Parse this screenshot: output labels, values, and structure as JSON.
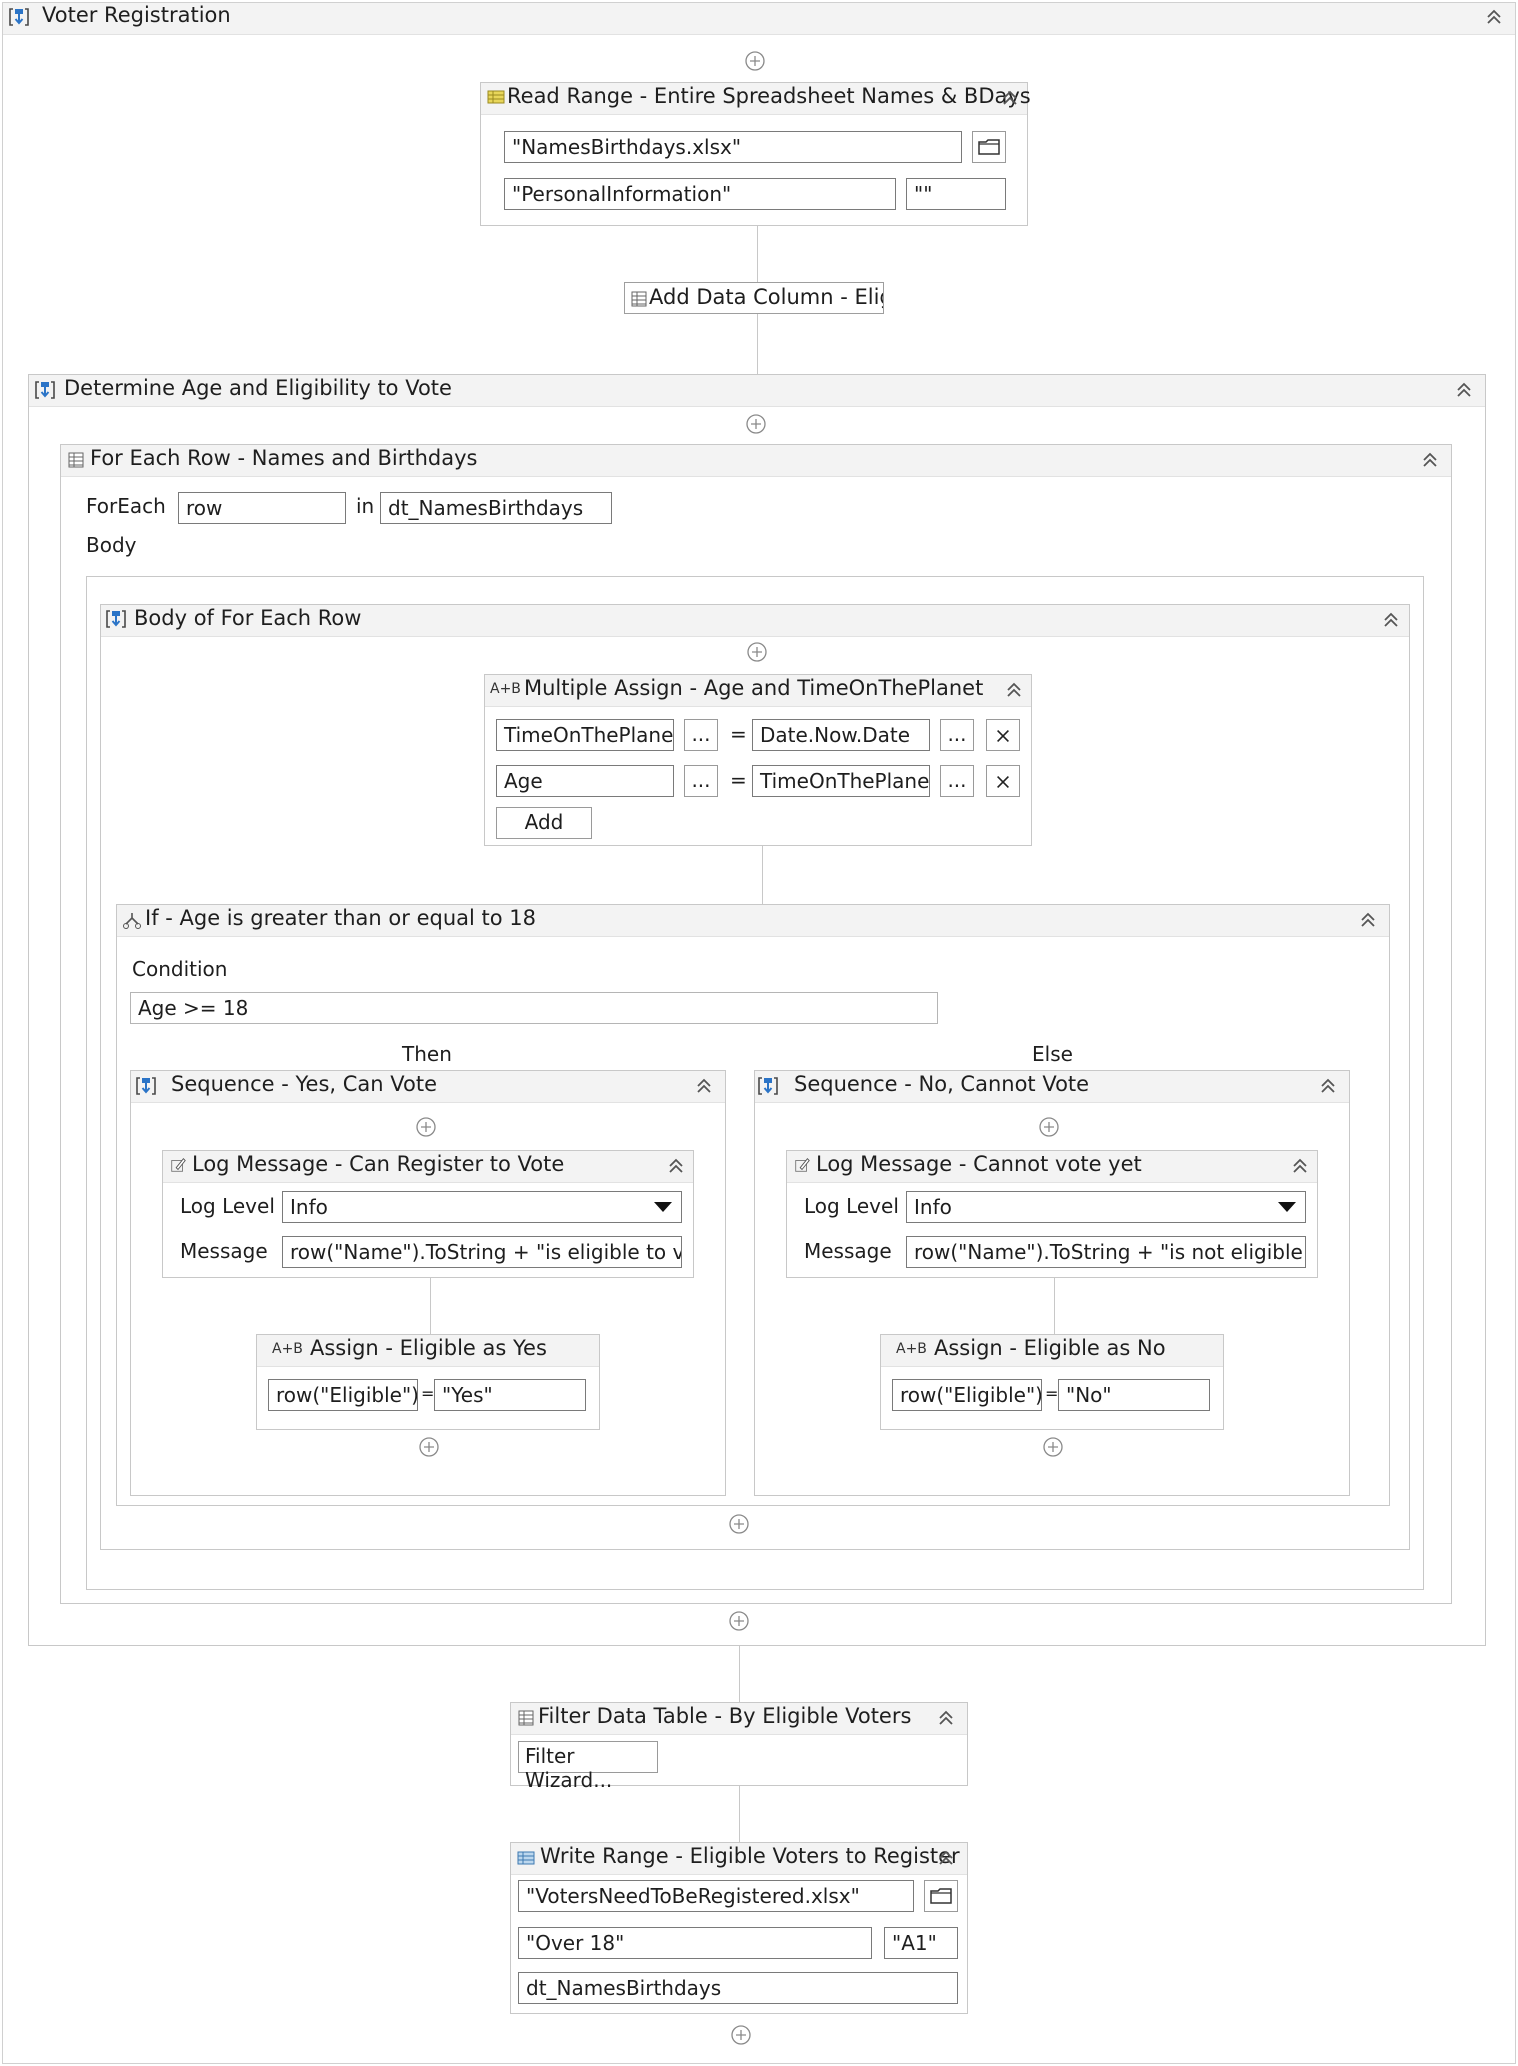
{
  "root": {
    "title": "Voter Registration"
  },
  "read_range": {
    "title": "Read Range - Entire Spreadsheet Names & BDays",
    "file": "\"NamesBirthdays.xlsx\"",
    "sheet": "\"PersonalInformation\"",
    "range": "\"\""
  },
  "add_column": {
    "title": "Add Data Column - Eligib"
  },
  "determine": {
    "title": "Determine Age and Eligibility to Vote"
  },
  "foreach": {
    "title": "For Each Row - Names and Birthdays",
    "foreach_label": "ForEach",
    "item": "row",
    "in_label": "in",
    "collection": "dt_NamesBirthdays",
    "body_label": "Body"
  },
  "body_seq": {
    "title": "Body of For Each Row"
  },
  "multi_assign": {
    "title": "Multiple Assign - Age and TimeOnThePlanet",
    "rows": [
      {
        "to": "TimeOnThePlanet",
        "value": "Date.Now.Date"
      },
      {
        "to": "Age",
        "value": "TimeOnThePlanet"
      }
    ],
    "ellipsis": "...",
    "equals": "=",
    "add_label": "Add"
  },
  "if_block": {
    "title": "If - Age is greater than or equal to 18",
    "condition_label": "Condition",
    "condition": "Age >= 18",
    "then_label": "Then",
    "else_label": "Else"
  },
  "then_seq": {
    "title": "Sequence - Yes, Can Vote",
    "log": {
      "title": "Log Message - Can Register to Vote",
      "level_label": "Log Level",
      "level": "Info",
      "message_label": "Message",
      "message": "row(\"Name\").ToString + \"is eligible to vote"
    },
    "assign": {
      "title": "Assign - Eligible as Yes",
      "to": "row(\"Eligible\")",
      "eq": "=",
      "value": "\"Yes\""
    }
  },
  "else_seq": {
    "title": "Sequence - No, Cannot Vote",
    "log": {
      "title": "Log Message - Cannot vote yet",
      "level_label": "Log Level",
      "level": "Info",
      "message_label": "Message",
      "message": "row(\"Name\").ToString + \"is not eligible to"
    },
    "assign": {
      "title": "Assign - Eligible as  No",
      "to": "row(\"Eligible\")",
      "eq": "=",
      "value": "\"No\""
    }
  },
  "filter": {
    "title": "Filter Data Table - By Eligible Voters",
    "wizard": "Filter Wizard..."
  },
  "write_range": {
    "title": "Write Range - Eligible Voters to Register",
    "file": "\"VotersNeedToBeRegistered.xlsx\"",
    "sheet": "\"Over 18\"",
    "cell": "\"A1\"",
    "table": "dt_NamesBirthdays"
  },
  "ab_tag": "A+B"
}
